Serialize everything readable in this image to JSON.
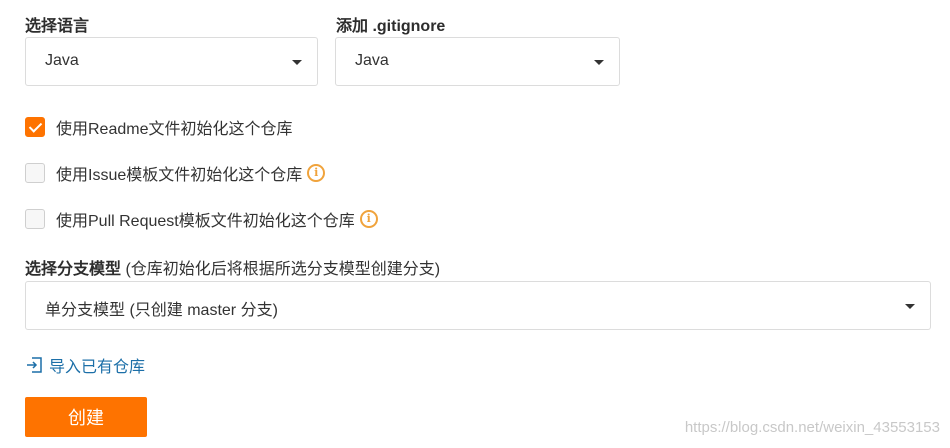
{
  "language": {
    "label": "选择语言",
    "selected": "Java"
  },
  "gitignore": {
    "label": "添加 .gitignore",
    "selected": "Java"
  },
  "options": {
    "readme": {
      "label": "使用Readme文件初始化这个仓库",
      "checked": true
    },
    "issue": {
      "label": "使用Issue模板文件初始化这个仓库",
      "checked": false
    },
    "pull_request": {
      "label": "使用Pull Request模板文件初始化这个仓库",
      "checked": false
    }
  },
  "branch_model": {
    "label": "选择分支模型",
    "hint": "(仓库初始化后将根据所选分支模型创建分支)",
    "selected": "单分支模型 (只创建 master 分支)"
  },
  "import_link": "导入已有仓库",
  "create_button": "创建",
  "watermark": "https://blog.csdn.net/weixin_43553153",
  "colors": {
    "accent": "#fe7300",
    "link": "#1c6fa8",
    "info": "#f0a33c"
  },
  "icons": {
    "caret": "chevron-down-icon",
    "check": "check-icon",
    "info": "info-icon",
    "import": "import-icon"
  }
}
